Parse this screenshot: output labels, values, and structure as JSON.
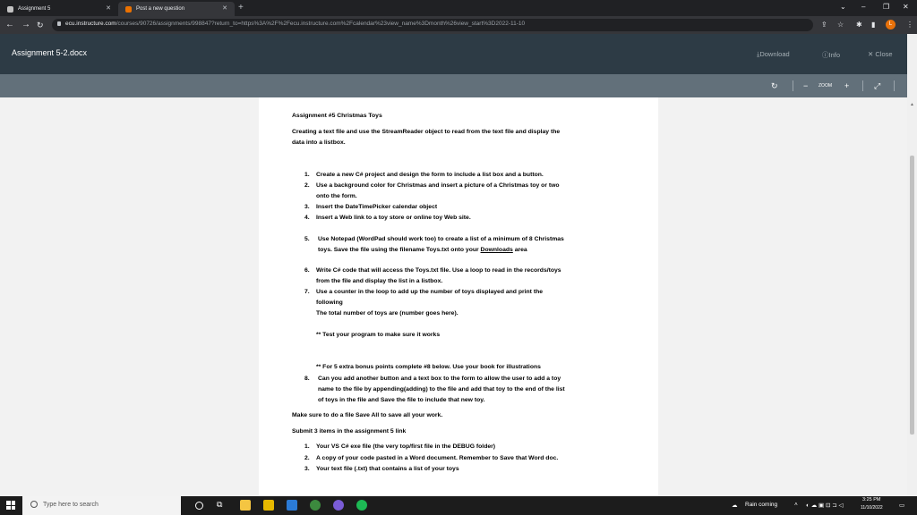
{
  "browser": {
    "tabs": [
      {
        "title": "Assignment 5",
        "favicon": "canvas-icon",
        "color": "#c2c2c2"
      },
      {
        "title": "Post a new question",
        "favicon": "chegg-icon",
        "color": "#eb7100"
      }
    ],
    "url_host": "ecu.instructure.com",
    "url_path": "/courses/90726/assignments/998847?return_to=https%3A%2F%2Fecu.instructure.com%2Fcalendar%23view_name%3Dmonth%26view_start%3D2022-11-10",
    "profile_initial": "L"
  },
  "doc_header": {
    "title": "Assignment 5-2.docx",
    "download_label": "Download",
    "info_label": "Info",
    "close_label": "Close"
  },
  "viewer": {
    "zoom_label": "ZOOM",
    "minus": "−",
    "plus": "+"
  },
  "document": {
    "heading": "Assignment #5    Christmas Toys",
    "intro_1": "Creating a text file and use the StreamReader object to read from the text file and display the",
    "intro_2": "data into a listbox.",
    "steps": [
      {
        "n": "1.",
        "lines": [
          "Create a new C# project and design the form to include a list box and a button."
        ]
      },
      {
        "n": "2.",
        "lines": [
          "Use a background color for Christmas and insert a picture of a Christmas toy or two",
          "onto the form."
        ]
      },
      {
        "n": "3.",
        "lines": [
          "Insert the DateTimePicker calendar object"
        ]
      },
      {
        "n": "4.",
        "lines": [
          "Insert a Web link to a toy store or online toy Web site."
        ]
      },
      {
        "n": "5.",
        "lines": [
          "Use Notepad (WordPad should work too) to create a list of a minimum of 8 Christmas",
          "toys.  Save the file using the filename Toys.txt onto your "
        ]
      },
      {
        "n": "6.",
        "lines": [
          "Write C# code that will access the Toys.txt file.  Use a loop to read in the records/toys",
          "from the file and display the list in a listbox."
        ]
      },
      {
        "n": "7.",
        "lines": [
          "Use a counter in the loop to add up the number of toys displayed and print the",
          "following",
          "The total number of toys are  (number goes here)."
        ]
      }
    ],
    "downloads_word": "Downloads",
    "area_word": " area",
    "test_note": "**  Test your program to make sure it works",
    "bonus_note": "**  For 5 extra bonus points complete #8 below.  Use your book for illustrations",
    "step8_n": "8.",
    "step8_lines": [
      "Can you add another button and a text box to the form to allow the user to add a toy",
      "name to the file by appending(adding) to the file and add that toy to the end of the list",
      "of toys in the file and Save the file to include that new toy."
    ],
    "save_all": "Make sure to do a file Save All to save all your work.",
    "submit": "Submit 3 items in the assignment 5 link",
    "submit_items": [
      {
        "n": "1.",
        "text": "Your VS C# exe file (the very top/first file in the DEBUG folder)"
      },
      {
        "n": "2.",
        "text": "A copy of your code pasted in a Word document.  Remember to Save that Word doc."
      },
      {
        "n": "3.",
        "text": "Your text file (.txt) that contains a list of your toys"
      }
    ]
  },
  "taskbar": {
    "search_placeholder": "Type here to search",
    "weather": "Rain coming",
    "time": "3:25 PM",
    "date": "11/10/2022"
  }
}
